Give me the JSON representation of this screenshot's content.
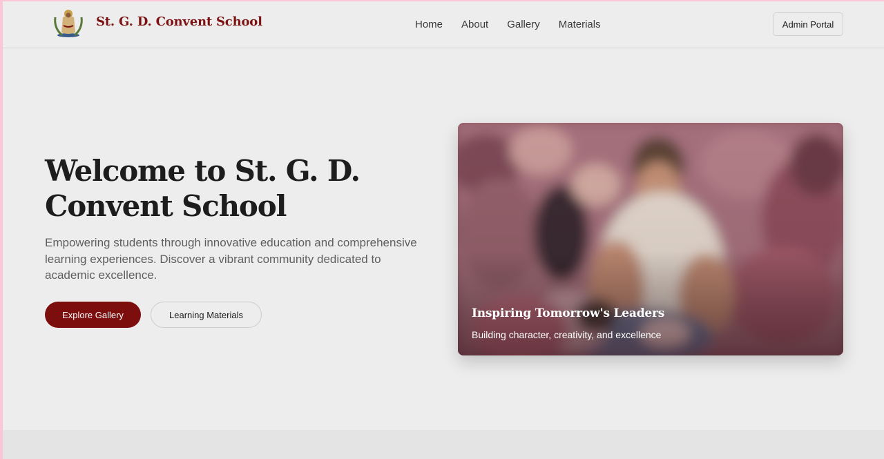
{
  "header": {
    "brand": "St. G. D. Convent School",
    "logo_icon": "saraswati-emblem-icon",
    "nav": [
      "Home",
      "About",
      "Gallery",
      "Materials"
    ],
    "admin_button": "Admin Portal"
  },
  "hero": {
    "title": "Welcome to St. G. D. Convent School",
    "description": "Empowering students through innovative education and comprehensive learning experiences. Discover a vibrant community dedicated to academic excellence.",
    "primary_button": "Explore Gallery",
    "secondary_button": "Learning Materials"
  },
  "feature_card": {
    "title": "Inspiring Tomorrow's Leaders",
    "subtitle": "Building character, creativity, and excellence"
  },
  "colors": {
    "brand": "#7c1212",
    "primary_button": "#7c0e0e",
    "background": "#ededed",
    "outer_border": "#f9c7d6"
  }
}
